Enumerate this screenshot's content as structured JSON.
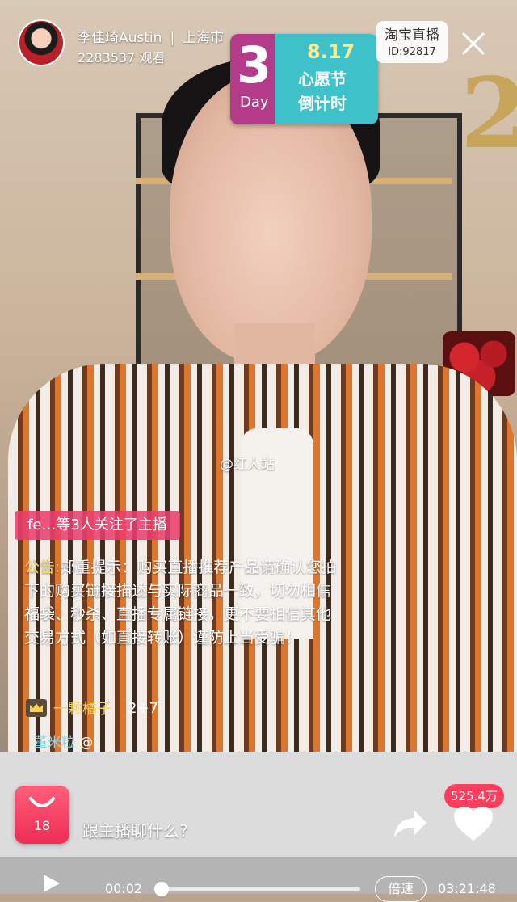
{
  "host": {
    "name": "李佳琦Austin",
    "location": "上海市",
    "viewers": "2283537 观看"
  },
  "promo_badge": {
    "countdown": "3",
    "unit": "Day",
    "date": "8.17",
    "line1": "心愿节",
    "line2": "倒计时"
  },
  "platform": {
    "name": "淘宝直播",
    "id": "ID:92817"
  },
  "icons": {
    "close": "close-icon",
    "crown": "crown-icon",
    "cart": "shopping-bag-icon",
    "share": "share-icon",
    "like": "heart-icon",
    "play": "play-icon"
  },
  "watermark": "@红人站",
  "follow_toast": "fe…等3人关注了主播",
  "notice": {
    "label": "公告:",
    "text": "郑重提示：购买直播推荐产品请确认您拍下的购买链接描述与实际商品一致，切勿相信福袋、秒杀、直播专属链接，更不要相信其他交易方式（如直接转账）谨防上当受骗！"
  },
  "fan_row": {
    "name": "一颗橘子",
    "count": "2+7"
  },
  "mention_row": {
    "name": "董米粒",
    "suffix": "@"
  },
  "cart": {
    "count": "18"
  },
  "chat": {
    "placeholder": "跟主播聊什么?"
  },
  "likes": {
    "count": "525.4万"
  },
  "player": {
    "current_time": "00:02",
    "total_time": "03:21:48",
    "speed_label": "倍速",
    "progress": 0.001
  },
  "colors": {
    "accent_pink": "#ee2c54",
    "toast_pink": "#e83f6e",
    "gold": "#f6d356",
    "mention_blue": "#7fd7f3"
  }
}
